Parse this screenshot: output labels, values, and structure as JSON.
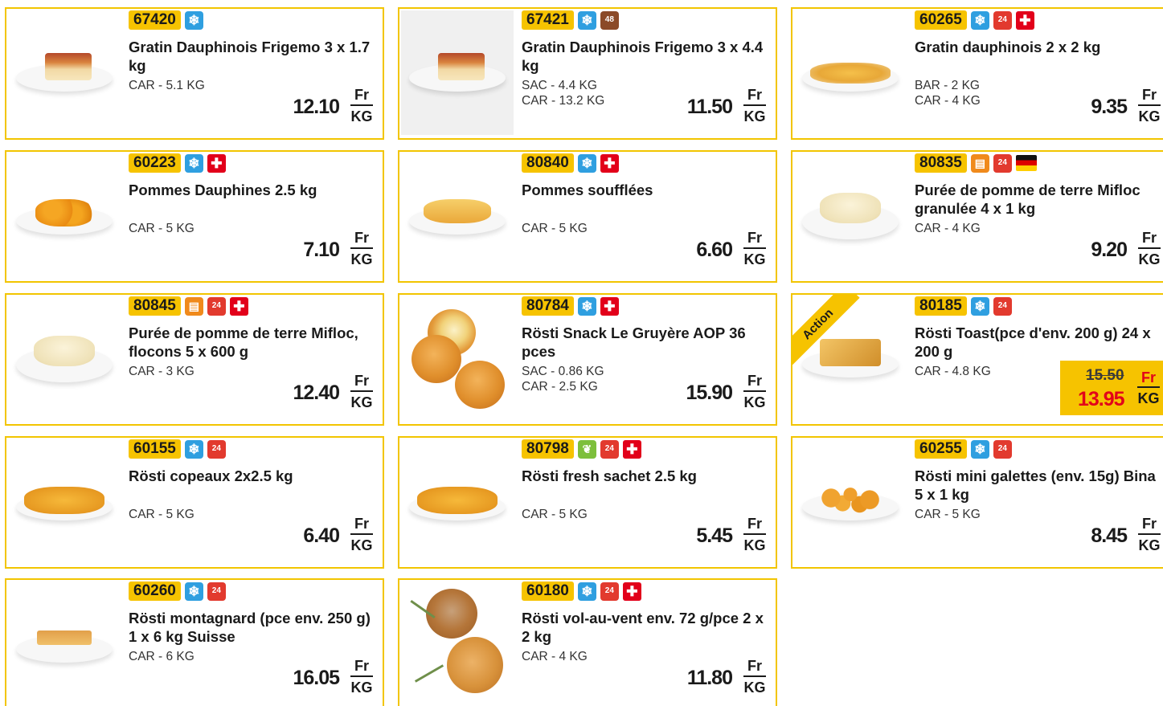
{
  "products": [
    {
      "code": "67420",
      "name": "Gratin Dauphinois Frigemo 3 x 1.7 kg",
      "packs": [
        "CAR - 5.1 KG"
      ],
      "price": "12.10",
      "unit_top": "Fr",
      "unit_bottom": "KG",
      "icons": [
        "frozen-icon"
      ]
    },
    {
      "code": "67421",
      "name": "Gratin Dauphinois Frigemo 3 x 4.4 kg",
      "packs": [
        "SAC - 4.4 KG",
        "CAR - 13.2 KG"
      ],
      "price": "11.50",
      "unit_top": "Fr",
      "unit_bottom": "KG",
      "icons": [
        "frozen-icon",
        "thaw-48h-icon"
      ],
      "thaw_label": "48"
    },
    {
      "code": "60265",
      "name": "Gratin dauphinois 2 x 2 kg",
      "packs": [
        "BAR - 2 KG",
        "CAR - 4 KG"
      ],
      "price": "9.35",
      "unit_top": "Fr",
      "unit_bottom": "KG",
      "icons": [
        "frozen-icon",
        "delivery-24h-icon",
        "swiss-flag-icon"
      ]
    },
    {
      "code": "60223",
      "name": "Pommes Dauphines 2.5 kg",
      "packs": [
        "CAR - 5 KG"
      ],
      "price": "7.10",
      "unit_top": "Fr",
      "unit_bottom": "KG",
      "icons": [
        "frozen-icon",
        "swiss-flag-icon"
      ]
    },
    {
      "code": "80840",
      "name": "Pommes soufflées",
      "packs": [
        "CAR - 5 KG"
      ],
      "price": "6.60",
      "unit_top": "Fr",
      "unit_bottom": "KG",
      "icons": [
        "frozen-icon",
        "swiss-flag-icon"
      ]
    },
    {
      "code": "80835",
      "name": "Purée de pomme de terre Mifloc granulée 4 x 1 kg",
      "packs": [
        "CAR - 4 KG"
      ],
      "price": "9.20",
      "unit_top": "Fr",
      "unit_bottom": "KG",
      "icons": [
        "dry-goods-icon",
        "delivery-24h-icon",
        "german-flag-icon"
      ]
    },
    {
      "code": "80845",
      "name": "Purée de pomme de terre Mifloc, flocons 5 x 600 g",
      "packs": [
        "CAR - 3 KG"
      ],
      "price": "12.40",
      "unit_top": "Fr",
      "unit_bottom": "KG",
      "icons": [
        "dry-goods-icon",
        "delivery-24h-icon",
        "swiss-flag-icon"
      ]
    },
    {
      "code": "80784",
      "name": "Rösti Snack Le Gruyère AOP 36 pces",
      "packs": [
        "SAC - 0.86 KG",
        "CAR - 2.5 KG"
      ],
      "price": "15.90",
      "unit_top": "Fr",
      "unit_bottom": "KG",
      "icons": [
        "frozen-icon",
        "swiss-flag-icon"
      ]
    },
    {
      "code": "80185",
      "name": "Rösti Toast(pce d'env. 200 g) 24 x 200 g",
      "packs": [
        "CAR - 4.8 KG"
      ],
      "old_price": "15.50",
      "price": "13.95",
      "unit_top": "Fr",
      "unit_bottom": "KG",
      "icons": [
        "frozen-icon",
        "delivery-24h-icon"
      ],
      "ribbon": "Action"
    },
    {
      "code": "60155",
      "name": "Rösti copeaux 2x2.5 kg",
      "packs": [
        "CAR - 5 KG"
      ],
      "price": "6.40",
      "unit_top": "Fr",
      "unit_bottom": "KG",
      "icons": [
        "frozen-icon",
        "delivery-24h-icon"
      ]
    },
    {
      "code": "80798",
      "name": "Rösti fresh sachet 2.5 kg",
      "packs": [
        "CAR - 5 KG"
      ],
      "price": "5.45",
      "unit_top": "Fr",
      "unit_bottom": "KG",
      "icons": [
        "fresh-leaf-icon",
        "delivery-24h-icon",
        "swiss-flag-icon"
      ]
    },
    {
      "code": "60255",
      "name": "Rösti mini galettes (env. 15g) Bina 5 x 1 kg",
      "packs": [
        "CAR - 5 KG"
      ],
      "price": "8.45",
      "unit_top": "Fr",
      "unit_bottom": "KG",
      "icons": [
        "frozen-icon",
        "delivery-24h-icon"
      ]
    },
    {
      "code": "60260",
      "name": "Rösti montagnard (pce env. 250 g) 1 x 6 kg Suisse",
      "packs": [
        "CAR - 6 KG"
      ],
      "price": "16.05",
      "unit_top": "Fr",
      "unit_bottom": "KG",
      "icons": [
        "frozen-icon",
        "delivery-24h-icon"
      ]
    },
    {
      "code": "60180",
      "name": "Rösti vol-au-vent env. 72 g/pce 2 x 2 kg",
      "packs": [
        "CAR - 4 KG"
      ],
      "price": "11.80",
      "unit_top": "Fr",
      "unit_bottom": "KG",
      "icons": [
        "frozen-icon",
        "delivery-24h-icon",
        "swiss-flag-icon"
      ]
    }
  ],
  "badge_24h_label": "24",
  "colors": {
    "accent": "#f6c300",
    "border": "#f2c500",
    "promo_red": "#e2001a",
    "frozen_blue": "#2f9fe0"
  }
}
